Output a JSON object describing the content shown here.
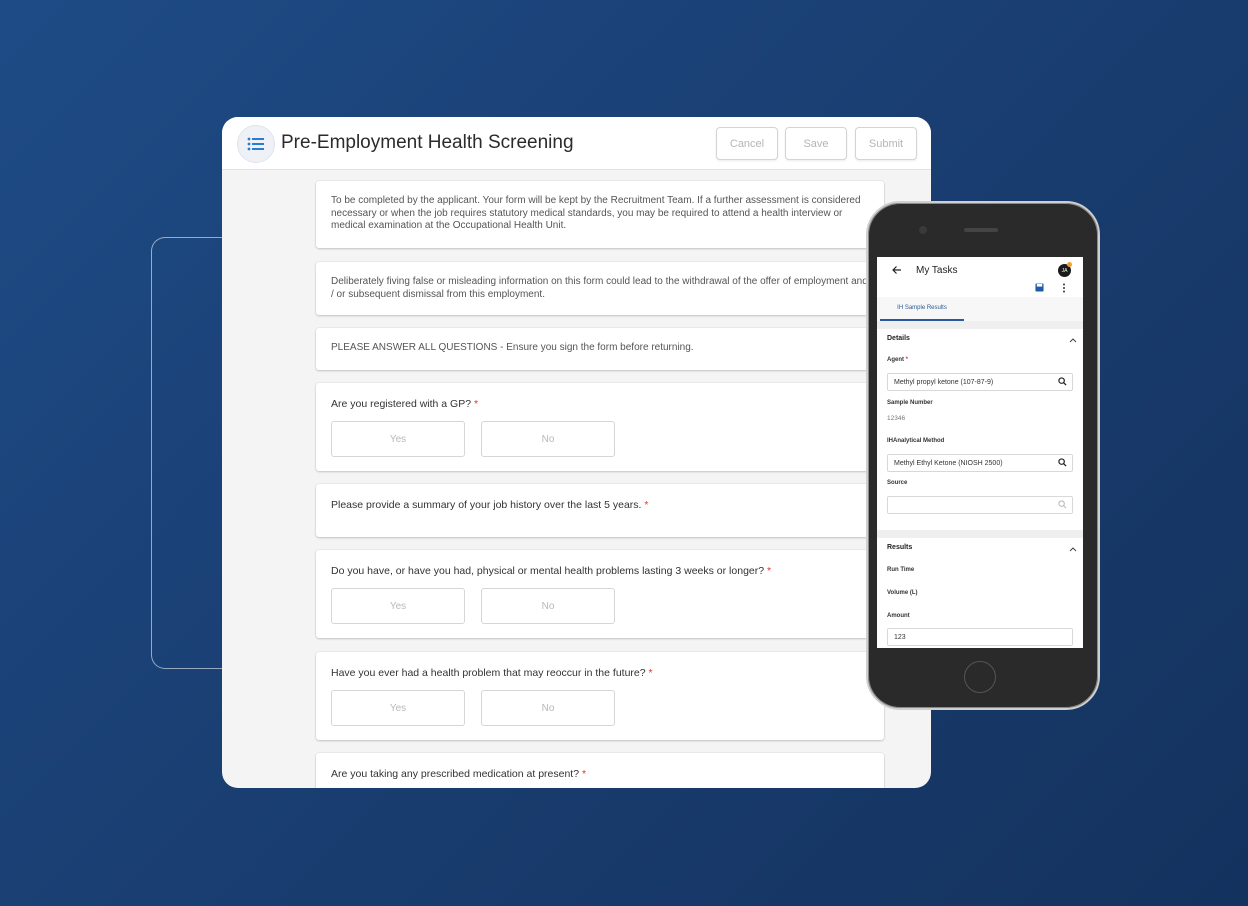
{
  "form": {
    "title": "Pre-Employment Health Screening",
    "buttons": {
      "cancel": "Cancel",
      "save": "Save",
      "submit": "Submit"
    },
    "intro_1": "To be completed by the applicant. Your form will be kept by the Recruitment Team. If a further assessment is considered necessary or when the job requires statutory medical standards, you may be required to attend a health interview or medical examination at the Occupational Health Unit.",
    "intro_2": "Deliberately fiving false or misleading information on this form could lead to the withdrawal of the offer of employment and / or subsequent dismissal from this employment.",
    "intro_3": "PLEASE ANSWER ALL QUESTIONS - Ensure you sign the form before returning.",
    "questions": [
      {
        "text": "Are you registered with a GP?",
        "yes": "Yes",
        "no": "No"
      },
      {
        "text": "Please provide a summary of your job history over the last 5 years."
      },
      {
        "text": "Do you have, or have you had, physical or mental health problems lasting 3 weeks or longer?",
        "yes": "Yes",
        "no": "No"
      },
      {
        "text": "Have you ever had a health problem that may reoccur in the future?",
        "yes": "Yes",
        "no": "No"
      },
      {
        "text": "Are you taking any prescribed medication at present?"
      }
    ],
    "required_marker": "*"
  },
  "mobile": {
    "title": "My Tasks",
    "avatar": "JA",
    "tab": "IH Sample Results",
    "details_header": "Details",
    "agent_label": "Agent",
    "agent_value": "Methyl propyl ketone (107-87-9)",
    "sample_number_label": "Sample Number",
    "sample_number_value": "12346",
    "method_label": "IHAnalytical Method",
    "method_value": "Methyl Ethyl Ketone (NIOSH 2500)",
    "source_label": "Source",
    "results_header": "Results",
    "run_time_label": "Run Time",
    "volume_label": "Volume (L)",
    "amount_label": "Amount",
    "amount_value": "123"
  },
  "colors": {
    "accent": "#2a5a9a",
    "required": "#dd3333",
    "menu_icon": "#2a7bd4"
  },
  "icons": [
    "list-icon",
    "back-arrow-icon",
    "save-icon",
    "more-vert-icon",
    "search-icon",
    "chevron-up-icon"
  ]
}
